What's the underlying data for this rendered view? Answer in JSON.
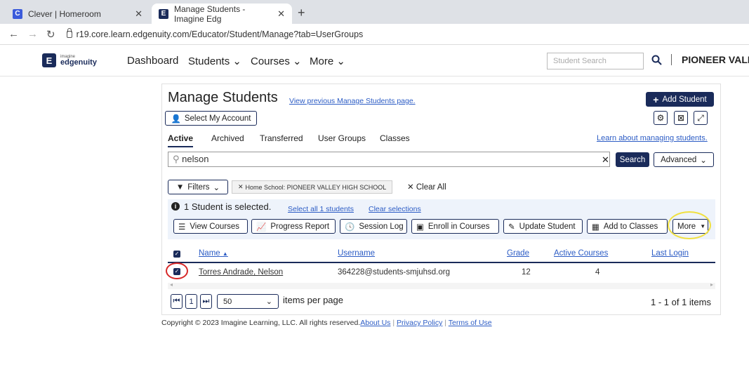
{
  "browser": {
    "tabs": [
      {
        "title": "Clever | Homeroom",
        "favicon": "C",
        "favicon_color": "#3b5bdb"
      },
      {
        "title": "Manage Students - Imagine Edg",
        "favicon": "E",
        "favicon_color": "#1a2b5a"
      }
    ],
    "new_tab": "+",
    "url": "r19.core.learn.edgenuity.com/Educator/Student/Manage?tab=UserGroups"
  },
  "header": {
    "logo_small": "imagine",
    "logo_main": "edgenuity",
    "nav": [
      "Dashboard",
      "Students",
      "Courses",
      "More"
    ],
    "search_placeholder": "Student Search",
    "school": "PIONEER VALLE"
  },
  "page": {
    "title": "Manage Students",
    "prev_link": "View previous Manage Students page.",
    "add_student": "Add Student",
    "select_account": "Select My Account",
    "learn_link": "Learn about managing students.",
    "tabs": [
      "Active",
      "Archived",
      "Transferred",
      "User Groups",
      "Classes"
    ],
    "search_value": "nelson",
    "search_button": "Search",
    "advanced": "Advanced",
    "filters": "Filters",
    "filter_chip": "Home School: PIONEER VALLEY HIGH SCHOOL",
    "clear_all": "Clear All",
    "selected_text": "1 Student is selected.",
    "select_all": "Select all 1 students",
    "clear_selections": "Clear selections",
    "actions": [
      "View Courses",
      "Progress Report",
      "Session Log",
      "Enroll in Courses",
      "Update Student",
      "Add to Classes",
      "More"
    ],
    "columns": [
      "Name",
      "Username",
      "Grade",
      "Active Courses",
      "Last Login"
    ],
    "rows": [
      {
        "name": "Torres Andrade, Nelson",
        "username": "364228@students-smjuhsd.org",
        "grade": "12",
        "active_courses": "4",
        "last_login": ""
      }
    ],
    "pager_page": "1",
    "per_page": "50",
    "items_per_page": "items per page",
    "range": "1 - 1 of 1 items"
  },
  "footer": {
    "copyright": "Copyright © 2023 Imagine Learning, LLC. All rights reserved.",
    "links": [
      "About Us",
      "Privacy Policy",
      "Terms of Use"
    ]
  },
  "colors": {
    "brand": "#1a2b5a",
    "link": "#2c5cc5",
    "highlight_circle": "#f0e040",
    "red_circle": "#d62828"
  }
}
